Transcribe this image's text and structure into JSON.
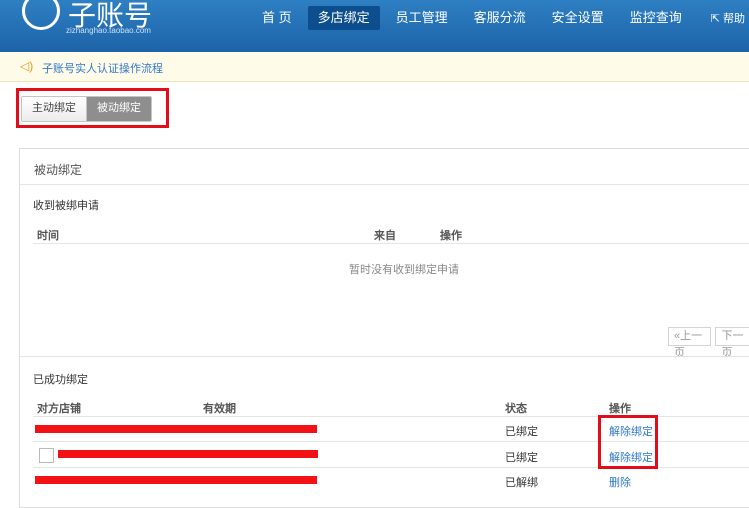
{
  "header": {
    "logo_title": "子账号",
    "logo_sub": "zizhanghao.taobao.com",
    "nav": [
      "首 页",
      "多店绑定",
      "员工管理",
      "客服分流",
      "安全设置",
      "监控查询"
    ],
    "active_nav": "多店绑定",
    "help": "帮助"
  },
  "notice": {
    "text": "子账号实人认证操作流程"
  },
  "tabs": {
    "active_binding": "主动绑定",
    "passive_binding": "被动绑定"
  },
  "panel": {
    "title": "被动绑定",
    "received": {
      "heading": "收到被绑申请",
      "col_time": "时间",
      "col_from": "来自",
      "col_action": "操作",
      "empty": "暂时没有收到绑定申请",
      "prev": "«上一页",
      "next": "下一页"
    },
    "bound": {
      "heading": "已成功绑定",
      "col_shop": "对方店铺",
      "col_valid": "有效期",
      "col_status": "状态",
      "col_action": "操作",
      "rows": [
        {
          "status": "已绑定",
          "action": "解除绑定"
        },
        {
          "status": "已绑定",
          "action": "解除绑定"
        },
        {
          "status": "已解绑",
          "action": "删除"
        }
      ]
    }
  },
  "colors": {
    "header": "#1d63a8",
    "link": "#2e78c7",
    "highlight": "#e20d19"
  }
}
